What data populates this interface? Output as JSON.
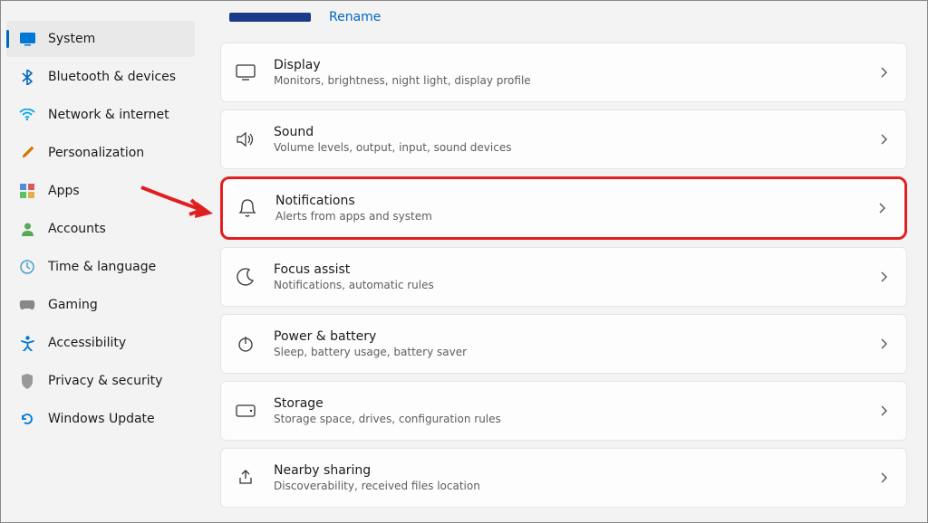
{
  "header": {
    "rename_link": "Rename"
  },
  "sidebar": {
    "items": [
      {
        "label": "System"
      },
      {
        "label": "Bluetooth & devices"
      },
      {
        "label": "Network & internet"
      },
      {
        "label": "Personalization"
      },
      {
        "label": "Apps"
      },
      {
        "label": "Accounts"
      },
      {
        "label": "Time & language"
      },
      {
        "label": "Gaming"
      },
      {
        "label": "Accessibility"
      },
      {
        "label": "Privacy & security"
      },
      {
        "label": "Windows Update"
      }
    ]
  },
  "main": {
    "cards": [
      {
        "title": "Display",
        "sub": "Monitors, brightness, night light, display profile"
      },
      {
        "title": "Sound",
        "sub": "Volume levels, output, input, sound devices"
      },
      {
        "title": "Notifications",
        "sub": "Alerts from apps and system"
      },
      {
        "title": "Focus assist",
        "sub": "Notifications, automatic rules"
      },
      {
        "title": "Power & battery",
        "sub": "Sleep, battery usage, battery saver"
      },
      {
        "title": "Storage",
        "sub": "Storage space, drives, configuration rules"
      },
      {
        "title": "Nearby sharing",
        "sub": "Discoverability, received files location"
      }
    ]
  },
  "colors": {
    "accent": "#0067c0",
    "highlight": "#e02020"
  }
}
